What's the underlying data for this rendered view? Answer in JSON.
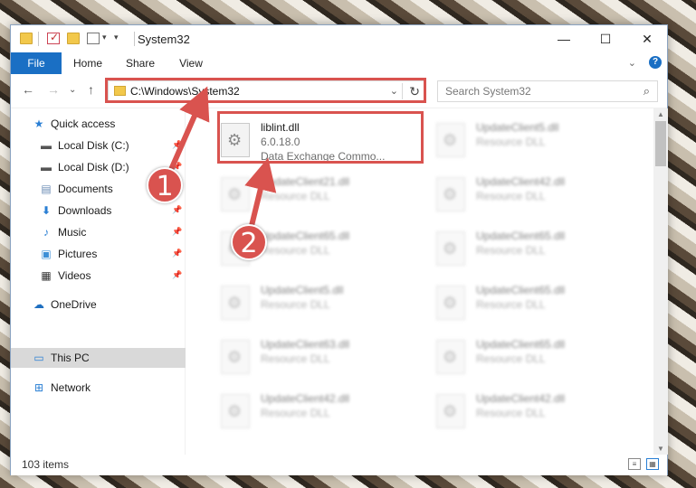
{
  "window": {
    "title": "System32",
    "minimize_glyph": "—",
    "maximize_glyph": "☐",
    "close_glyph": "✕"
  },
  "ribbon": {
    "tabs": [
      "File",
      "Home",
      "Share",
      "View"
    ],
    "help_glyph": "?",
    "collapse_glyph": "⌄"
  },
  "nav": {
    "back_glyph": "←",
    "forward_glyph": "→",
    "recent_glyph": "⌄",
    "up_glyph": "↑",
    "address_path": "C:\\Windows\\System32",
    "address_dropdown_glyph": "⌄",
    "refresh_glyph": "↻",
    "search_placeholder": "Search System32",
    "search_glyph": "⌕"
  },
  "sidebar": {
    "items": [
      {
        "label": "Quick access",
        "icon": "star-icon"
      },
      {
        "label": "Local Disk (C:)",
        "icon": "drive-icon"
      },
      {
        "label": "Local Disk (D:)",
        "icon": "drive-icon"
      },
      {
        "label": "Documents",
        "icon": "documents-icon"
      },
      {
        "label": "Downloads",
        "icon": "download-icon"
      },
      {
        "label": "Music",
        "icon": "music-icon"
      },
      {
        "label": "Pictures",
        "icon": "pictures-icon"
      },
      {
        "label": "Videos",
        "icon": "videos-icon"
      },
      {
        "label": "OneDrive",
        "icon": "cloud-icon"
      },
      {
        "label": "This PC",
        "icon": "computer-icon"
      },
      {
        "label": "Network",
        "icon": "network-icon"
      }
    ],
    "pin_glyph": "📌"
  },
  "files": [
    {
      "name": "liblint.dll",
      "line2": "6.0.18.0",
      "line3": "Data Exchange Commo...",
      "blurred": false
    },
    {
      "name": "UpdateClient5.dll",
      "line2": "Resource DLL",
      "blurred": true
    },
    {
      "name": "UpdateClient21.dll",
      "line2": "Resource DLL",
      "blurred": true
    },
    {
      "name": "UpdateClient42.dll",
      "line2": "Resource DLL",
      "blurred": true
    },
    {
      "name": "UpdateClient65.dll",
      "line2": "Resource DLL",
      "blurred": true
    },
    {
      "name": "UpdateClient65.dll",
      "line2": "Resource DLL",
      "blurred": true
    },
    {
      "name": "UpdateClient5.dll",
      "line2": "Resource DLL",
      "blurred": true
    },
    {
      "name": "UpdateClient65.dll",
      "line2": "Resource DLL",
      "blurred": true
    },
    {
      "name": "UpdateClient63.dll",
      "line2": "Resource DLL",
      "blurred": true
    },
    {
      "name": "UpdateClient65.dll",
      "line2": "Resource DLL",
      "blurred": true
    },
    {
      "name": "UpdateClient42.dll",
      "line2": "Resource DLL",
      "blurred": true
    },
    {
      "name": "UpdateClient42.dll",
      "line2": "Resource DLL",
      "blurred": true
    }
  ],
  "status": {
    "item_count": "103 items"
  },
  "annotations": {
    "step1": "1",
    "step2": "2",
    "color": "#d9534f"
  }
}
